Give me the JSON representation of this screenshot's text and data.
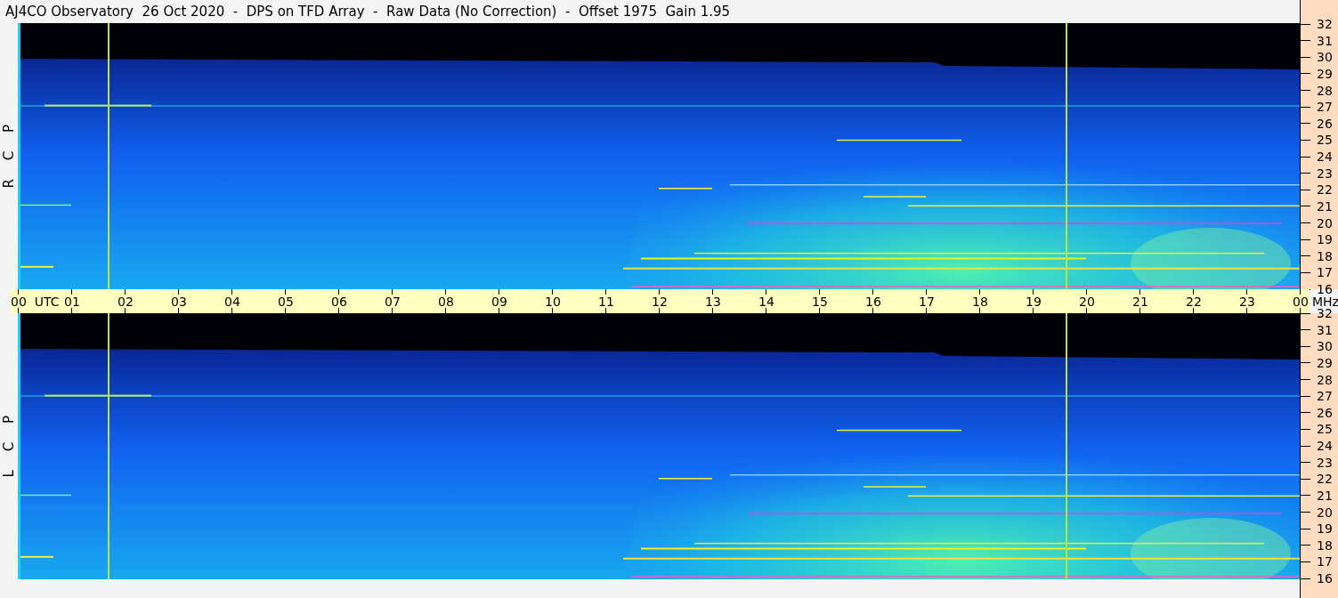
{
  "title": "AJ4CO Observatory  26 Oct 2020  -  DPS on TFD Array  -  Raw Data (No Correction)  -  Offset 1975  Gain 1.95",
  "panels": [
    {
      "label": "R C P",
      "frequency_ticks": [
        "32",
        "31",
        "30",
        "29",
        "28",
        "27",
        "26",
        "25",
        "24",
        "23",
        "22",
        "21",
        "20",
        "19",
        "18",
        "17",
        "16"
      ]
    },
    {
      "label": "L C P",
      "frequency_ticks": [
        "32",
        "31",
        "30",
        "29",
        "28",
        "27",
        "26",
        "25",
        "24",
        "23",
        "22",
        "21",
        "20",
        "19",
        "18",
        "17",
        "16"
      ]
    }
  ],
  "time_axis": {
    "ticks": [
      "00",
      "01",
      "02",
      "03",
      "04",
      "05",
      "06",
      "07",
      "08",
      "09",
      "10",
      "11",
      "12",
      "13",
      "14",
      "15",
      "16",
      "17",
      "18",
      "19",
      "20",
      "21",
      "22",
      "23",
      "00"
    ],
    "time_unit": "UTC",
    "frequency_unit": "MHz"
  }
}
